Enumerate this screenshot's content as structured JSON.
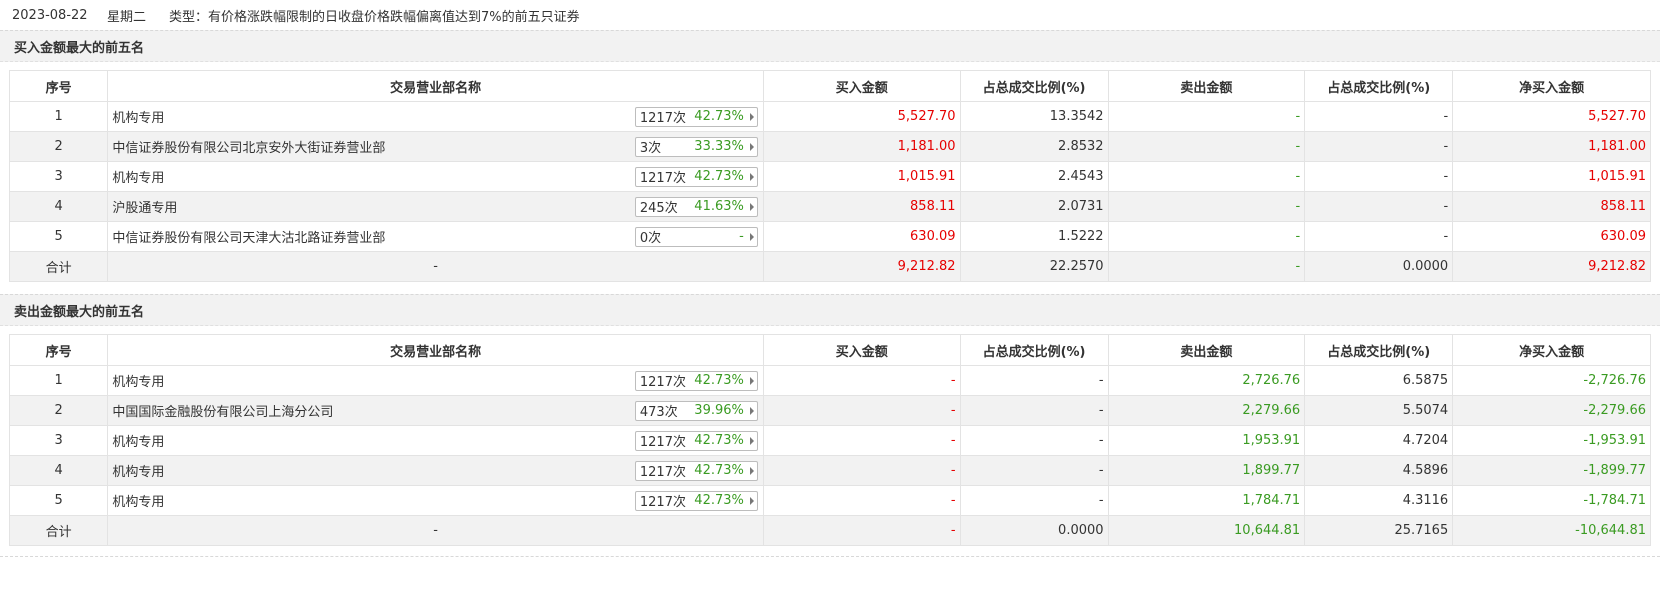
{
  "header": {
    "date": "2023-08-22",
    "weekday": "星期二",
    "type_text": "类型：有价格涨跌幅限制的日收盘价格跌幅偏离值达到7%的前五只证券"
  },
  "columns": [
    "序号",
    "交易营业部名称",
    "买入金额",
    "占总成交比例(%)",
    "卖出金额",
    "占总成交比例(%)",
    "净买入金额"
  ],
  "buy_section": {
    "title": "买入金额最大的前五名",
    "rows": [
      {
        "idx": "1",
        "name": "机构专用",
        "count": "1217次",
        "pct": "42.73%",
        "buy": "5,527.70",
        "buy_ratio": "13.3542",
        "sell": "-",
        "sell_ratio": "-",
        "net": "5,527.70"
      },
      {
        "idx": "2",
        "name": "中信证券股份有限公司北京安外大街证券营业部",
        "count": "3次",
        "pct": "33.33%",
        "buy": "1,181.00",
        "buy_ratio": "2.8532",
        "sell": "-",
        "sell_ratio": "-",
        "net": "1,181.00"
      },
      {
        "idx": "3",
        "name": "机构专用",
        "count": "1217次",
        "pct": "42.73%",
        "buy": "1,015.91",
        "buy_ratio": "2.4543",
        "sell": "-",
        "sell_ratio": "-",
        "net": "1,015.91"
      },
      {
        "idx": "4",
        "name": "沪股通专用",
        "count": "245次",
        "pct": "41.63%",
        "buy": "858.11",
        "buy_ratio": "2.0731",
        "sell": "-",
        "sell_ratio": "-",
        "net": "858.11"
      },
      {
        "idx": "5",
        "name": "中信证券股份有限公司天津大沽北路证券营业部",
        "count": "0次",
        "pct": "-",
        "buy": "630.09",
        "buy_ratio": "1.5222",
        "sell": "-",
        "sell_ratio": "-",
        "net": "630.09"
      }
    ],
    "total": {
      "label": "合计",
      "name": "-",
      "buy": "9,212.82",
      "buy_ratio": "22.2570",
      "sell": "-",
      "sell_ratio": "0.0000",
      "net": "9,212.82"
    }
  },
  "sell_section": {
    "title": "卖出金额最大的前五名",
    "rows": [
      {
        "idx": "1",
        "name": "机构专用",
        "count": "1217次",
        "pct": "42.73%",
        "buy": "-",
        "buy_ratio": "-",
        "sell": "2,726.76",
        "sell_ratio": "6.5875",
        "net": "-2,726.76"
      },
      {
        "idx": "2",
        "name": "中国国际金融股份有限公司上海分公司",
        "count": "473次",
        "pct": "39.96%",
        "buy": "-",
        "buy_ratio": "-",
        "sell": "2,279.66",
        "sell_ratio": "5.5074",
        "net": "-2,279.66"
      },
      {
        "idx": "3",
        "name": "机构专用",
        "count": "1217次",
        "pct": "42.73%",
        "buy": "-",
        "buy_ratio": "-",
        "sell": "1,953.91",
        "sell_ratio": "4.7204",
        "net": "-1,953.91"
      },
      {
        "idx": "4",
        "name": "机构专用",
        "count": "1217次",
        "pct": "42.73%",
        "buy": "-",
        "buy_ratio": "-",
        "sell": "1,899.77",
        "sell_ratio": "4.5896",
        "net": "-1,899.77"
      },
      {
        "idx": "5",
        "name": "机构专用",
        "count": "1217次",
        "pct": "42.73%",
        "buy": "-",
        "buy_ratio": "-",
        "sell": "1,784.71",
        "sell_ratio": "4.3116",
        "net": "-1,784.71"
      }
    ],
    "total": {
      "label": "合计",
      "name": "-",
      "buy": "-",
      "buy_ratio": "0.0000",
      "sell": "10,644.81",
      "sell_ratio": "25.7165",
      "net": "-10,644.81"
    }
  },
  "colors": {
    "up": "#e60000",
    "down": "#3a9b22",
    "header_bg": "#f2f2f2"
  },
  "icons": {
    "badge_arrow": "caret-right-icon"
  }
}
